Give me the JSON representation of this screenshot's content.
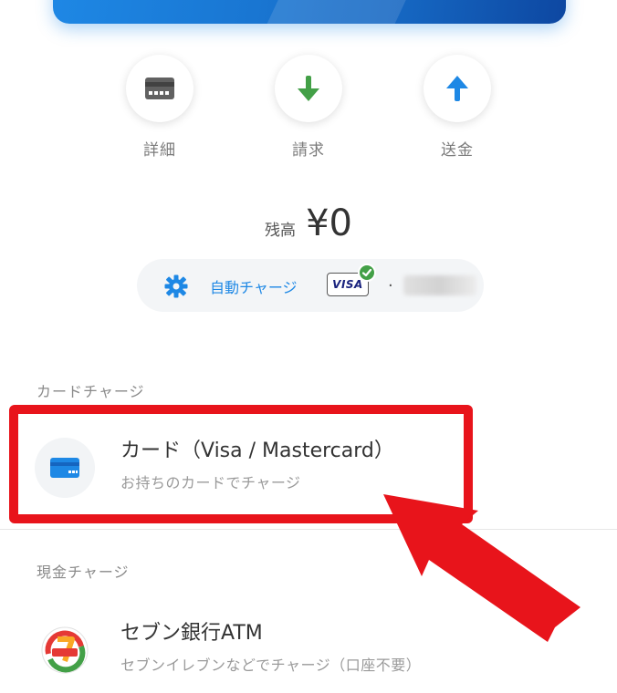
{
  "actions": [
    {
      "label": "詳細",
      "icon": "card-detail-icon"
    },
    {
      "label": "請求",
      "icon": "arrow-down-icon"
    },
    {
      "label": "送金",
      "icon": "arrow-up-icon"
    }
  ],
  "balance": {
    "label": "残高",
    "value": "¥0"
  },
  "auto_charge": {
    "label": "自動チャージ",
    "card_brand": "VISA",
    "masked_prefix": "."
  },
  "sections": [
    {
      "title": "カードチャージ",
      "items": [
        {
          "title": "カード（Visa / Mastercard）",
          "subtitle": "お持ちのカードでチャージ",
          "icon": "credit-card-icon"
        }
      ]
    },
    {
      "title": "現金チャージ",
      "items": [
        {
          "title": "セブン銀行ATM",
          "subtitle": "セブンイレブンなどでチャージ（口座不要）",
          "icon": "seven-bank-icon"
        }
      ]
    }
  ],
  "colors": {
    "accent_blue": "#1e88e5",
    "green": "#43a047",
    "highlight_red": "#e8141b"
  }
}
